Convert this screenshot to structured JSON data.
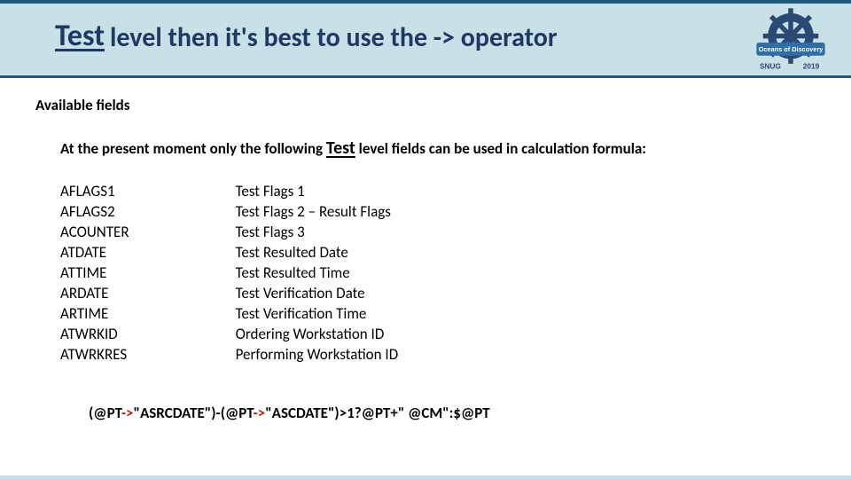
{
  "header": {
    "keyword": "Test",
    "title_rest": "level then it's best to use the  -> operator"
  },
  "logo": {
    "banner_text": "Oceans of Discovery",
    "footer_left": "SNUG",
    "footer_right": "2019"
  },
  "section_heading": "Available fields",
  "intro": {
    "before": "At the present moment only the following ",
    "keyword": "Test",
    "after": " level fields can be used in calculation formula:"
  },
  "fields": {
    "names": [
      "AFLAGS1",
      "AFLAGS2",
      "ACOUNTER",
      "ATDATE",
      "ATTIME",
      "ARDATE",
      "ARTIME",
      "ATWRKID",
      "ATWRKRES"
    ],
    "descs": [
      "Test Flags 1",
      "Test Flags 2 – Result Flags",
      "Test Flags 3",
      "Test Resulted Date",
      "Test Resulted Time",
      "Test Verification Date",
      "Test Verification Time",
      "Ordering Workstation ID",
      "Performing Workstation ID"
    ]
  },
  "formula": {
    "p1": "(@PT",
    "op1": "->",
    "p2": "\"ASRCDATE\")-(@PT",
    "op2": "->",
    "p3": "\"ASCDATE\")>1?@PT+\" @CM\":$@PT"
  }
}
